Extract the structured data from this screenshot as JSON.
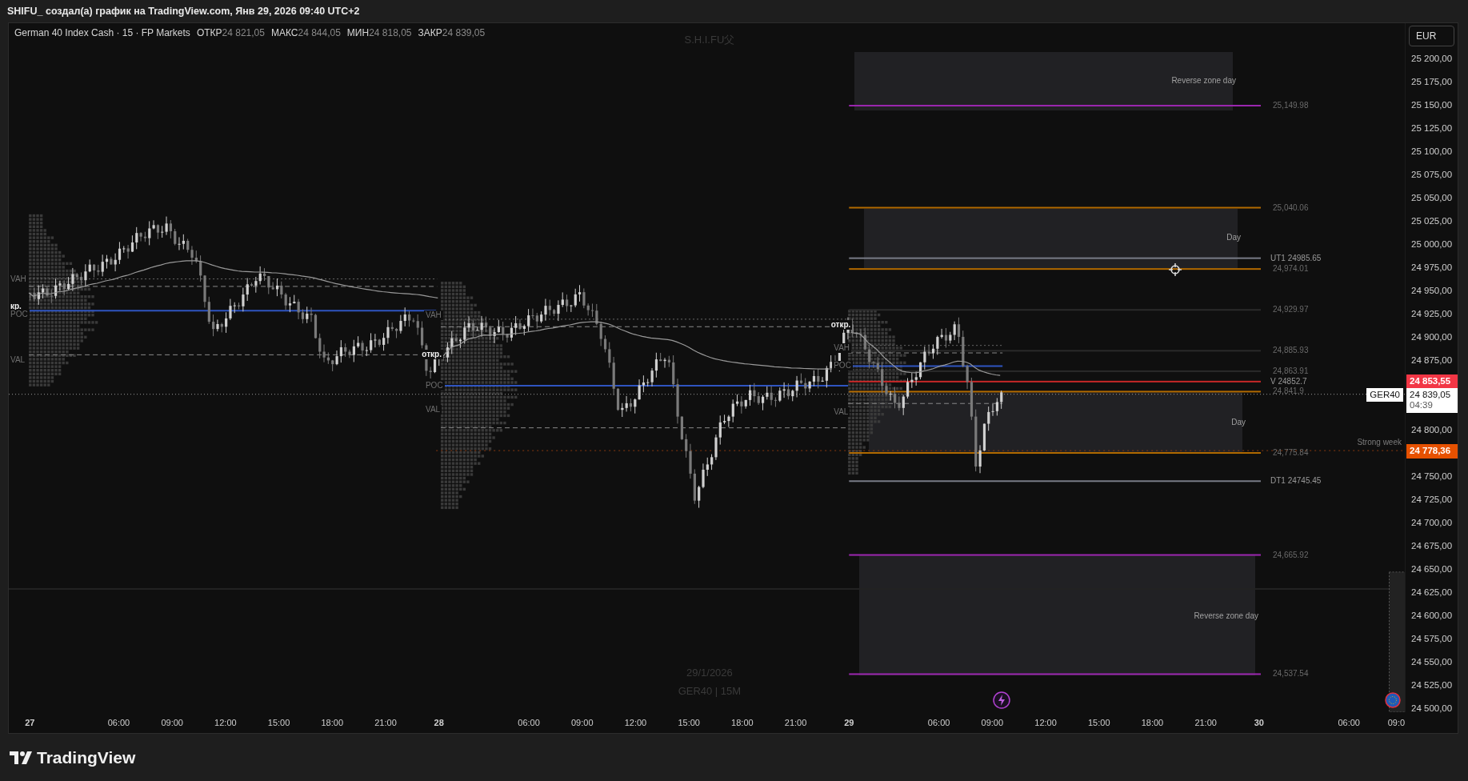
{
  "title_bar": {
    "text": "SHIFU_ создал(а) график на TradingView.com, Янв 29, 2026 09:40 UTC+2"
  },
  "legend": {
    "symbol": "German 40 Index Cash · 15 · FP Markets",
    "ohlc": [
      {
        "label": "ОТКР",
        "value": "24 821,05"
      },
      {
        "label": "МАКС",
        "value": "24 844,05"
      },
      {
        "label": "МИН",
        "value": "24 818,05"
      },
      {
        "label": "ЗАКР",
        "value": "24 839,05"
      }
    ]
  },
  "watermarks": [
    "S.H.I.FU父",
    "29/1/2026",
    "GER40 | 15M"
  ],
  "currency_button": "EUR",
  "profiles": [
    {
      "labels": [
        {
          "text": "VAH",
          "kind": "level"
        },
        {
          "text": "кр.",
          "kind": "open"
        },
        {
          "text": "POC",
          "kind": "level"
        },
        {
          "text": "VAL",
          "kind": "level"
        }
      ]
    },
    {
      "labels": [
        {
          "text": "VAH",
          "kind": "level"
        },
        {
          "text": "откр.",
          "kind": "open"
        },
        {
          "text": "POC",
          "kind": "level"
        },
        {
          "text": "VAL",
          "kind": "level"
        }
      ]
    },
    {
      "labels": [
        {
          "text": "откр.",
          "kind": "open"
        },
        {
          "text": "VAH",
          "kind": "level"
        },
        {
          "text": "POC",
          "kind": "level"
        },
        {
          "text": "VAL",
          "kind": "level"
        }
      ]
    }
  ],
  "levels": [
    {
      "label": "25,149.98",
      "kind": "price",
      "color": "#9c27b0"
    },
    {
      "label": "25,040.06",
      "kind": "price",
      "color": "#b26a00"
    },
    {
      "label": "UT1 24985.65",
      "kind": "named",
      "color": "#787b86"
    },
    {
      "label": "24,974.01",
      "kind": "price",
      "color": "#b26a00"
    },
    {
      "label": "24,929.97",
      "kind": "price",
      "color": "#2a2a2a"
    },
    {
      "label": "24,885.93",
      "kind": "price",
      "color": "#2a2a2a"
    },
    {
      "label": "24,863.91",
      "kind": "price",
      "color": "#2a2a2a"
    },
    {
      "label": "V 24852.7",
      "kind": "named",
      "color": "#c62828"
    },
    {
      "label": "24,841.9",
      "kind": "price",
      "color": "#b26a00"
    },
    {
      "label": "24,775.84",
      "kind": "price",
      "color": "#b26a00"
    },
    {
      "label": "DT1 24745.45",
      "kind": "named",
      "color": "#787b86"
    },
    {
      "label": "24,665.92",
      "kind": "price",
      "color": "#9c27b0"
    },
    {
      "label": "24,537.54",
      "kind": "price",
      "color": "#9c27b0"
    }
  ],
  "zones": [
    {
      "label": "Reverse zone day"
    },
    {
      "label": "Day"
    },
    {
      "label": "Day"
    },
    {
      "label": "Reverse zone day"
    }
  ],
  "strong_week": {
    "label": "Strong week"
  },
  "price_axis": {
    "ticks": [
      "25 200,00",
      "25 175,00",
      "25 150,00",
      "25 125,00",
      "25 100,00",
      "25 075,00",
      "25 050,00",
      "25 025,00",
      "25 000,00",
      "24 975,00",
      "24 950,00",
      "24 925,00",
      "24 900,00",
      "24 875,00",
      "24 800,00",
      "24 750,00",
      "24 725,00",
      "24 700,00",
      "24 675,00",
      "24 650,00",
      "24 625,00",
      "24 600,00",
      "24 575,00",
      "24 550,00",
      "24 525,00",
      "24 500,00"
    ],
    "badges": [
      {
        "text": "24 853,55",
        "color": "#f23645"
      },
      {
        "text": "24 778,36",
        "color": "#e65100"
      }
    ],
    "last_price": {
      "symbol": "GER40",
      "price": "24 839,05",
      "countdown": "04:39"
    }
  },
  "time_axis": [
    {
      "text": "27",
      "kind": "day"
    },
    {
      "text": "06:00",
      "kind": "time"
    },
    {
      "text": "09:00",
      "kind": "time"
    },
    {
      "text": "12:00",
      "kind": "time"
    },
    {
      "text": "15:00",
      "kind": "time"
    },
    {
      "text": "18:00",
      "kind": "time"
    },
    {
      "text": "21:00",
      "kind": "time"
    },
    {
      "text": "28",
      "kind": "day"
    },
    {
      "text": "06:00",
      "kind": "time"
    },
    {
      "text": "09:00",
      "kind": "time"
    },
    {
      "text": "12:00",
      "kind": "time"
    },
    {
      "text": "15:00",
      "kind": "time"
    },
    {
      "text": "18:00",
      "kind": "time"
    },
    {
      "text": "21:00",
      "kind": "time"
    },
    {
      "text": "29",
      "kind": "day"
    },
    {
      "text": "06:00",
      "kind": "time"
    },
    {
      "text": "09:00",
      "kind": "time"
    },
    {
      "text": "12:00",
      "kind": "time"
    },
    {
      "text": "15:00",
      "kind": "time"
    },
    {
      "text": "18:00",
      "kind": "time"
    },
    {
      "text": "21:00",
      "kind": "time"
    },
    {
      "text": "30",
      "kind": "day"
    },
    {
      "text": "06:00",
      "kind": "time"
    },
    {
      "text": "09:0",
      "kind": "time"
    }
  ],
  "footer": {
    "logo": "TradingView"
  }
}
